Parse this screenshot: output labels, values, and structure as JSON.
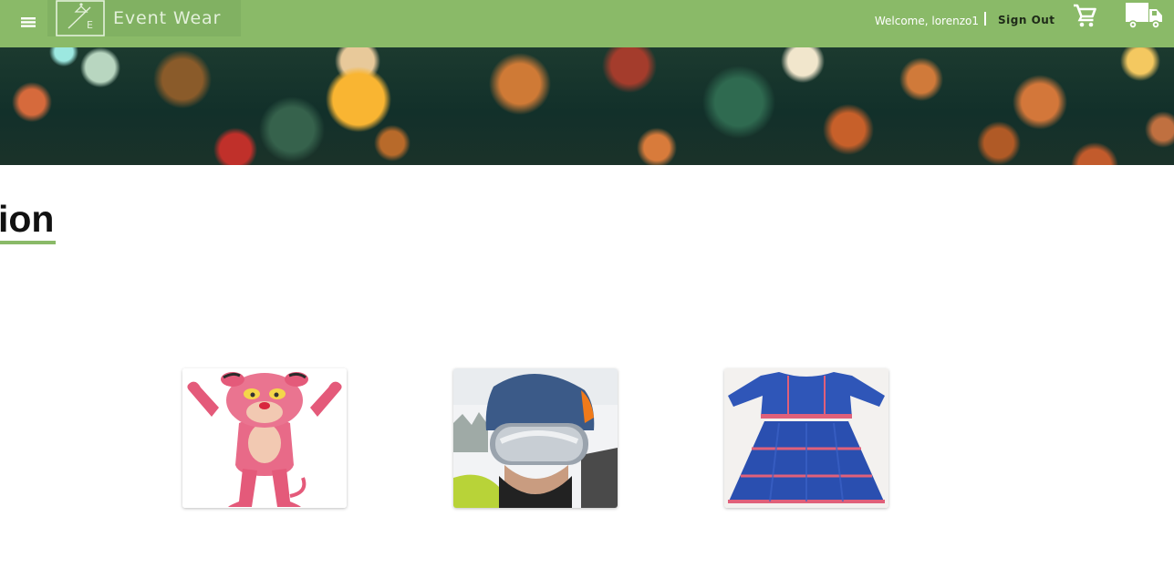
{
  "header": {
    "brand_name": "Event Wear",
    "logo_letter": "E",
    "welcome_text": "Welcome, lorenzo1",
    "sign_out_label": "Sign Out",
    "icons": [
      "menu-icon",
      "hanger-logo-icon",
      "cart-icon",
      "delivery-truck-icon"
    ],
    "colors": {
      "bar": "#8aba68",
      "accent": "#8aba68"
    }
  },
  "section": {
    "title_visible": "ion"
  },
  "products": [
    {
      "image": "pink-panther-mascot-costume"
    },
    {
      "image": "ski-helmet-goggles-selfie"
    },
    {
      "image": "blue-ruffled-dress"
    }
  ]
}
